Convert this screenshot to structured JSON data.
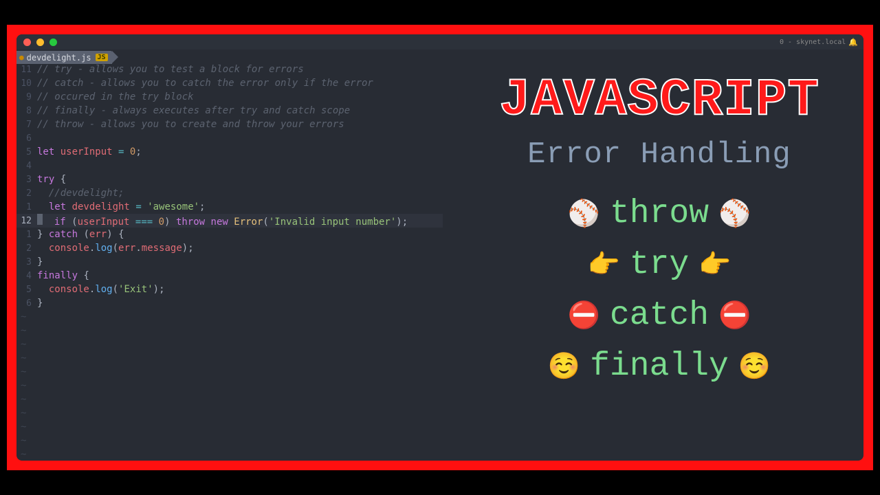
{
  "window": {
    "host_label": "0 - skynet.local"
  },
  "tab": {
    "filename": "devdelight.js",
    "badge": "JS"
  },
  "code": {
    "lines": [
      {
        "n": "11",
        "tokens": [
          [
            "cm",
            "// try - allows you to test a block for errors"
          ]
        ]
      },
      {
        "n": "10",
        "tokens": [
          [
            "cm",
            "// catch - allows you to catch the error only if the error"
          ]
        ]
      },
      {
        "n": "9",
        "tokens": [
          [
            "cm",
            "// occured in the try block"
          ]
        ]
      },
      {
        "n": "8",
        "tokens": [
          [
            "cm",
            "// finally - always executes after try and catch scope"
          ]
        ]
      },
      {
        "n": "7",
        "tokens": [
          [
            "cm",
            "// throw - allows you to create and throw your errors"
          ]
        ]
      },
      {
        "n": "6",
        "tokens": []
      },
      {
        "n": "5",
        "tokens": [
          [
            "kw",
            "let "
          ],
          [
            "vr",
            "userInput"
          ],
          [
            "ct",
            " "
          ],
          [
            "op",
            "="
          ],
          [
            "ct",
            " "
          ],
          [
            "nm",
            "0"
          ],
          [
            "pn",
            ";"
          ]
        ]
      },
      {
        "n": "4",
        "tokens": []
      },
      {
        "n": "3",
        "tokens": [
          [
            "kw",
            "try"
          ],
          [
            "ct",
            " "
          ],
          [
            "pn",
            "{"
          ]
        ]
      },
      {
        "n": "2",
        "tokens": [
          [
            "ct",
            "  "
          ],
          [
            "cm",
            "//devdelight;"
          ]
        ]
      },
      {
        "n": "1",
        "tokens": [
          [
            "ct",
            "  "
          ],
          [
            "kw",
            "let "
          ],
          [
            "vr",
            "devdelight"
          ],
          [
            "ct",
            " "
          ],
          [
            "op",
            "="
          ],
          [
            "ct",
            " "
          ],
          [
            "st",
            "'awesome'"
          ],
          [
            "pn",
            ";"
          ]
        ]
      },
      {
        "n": "12",
        "current": true,
        "tokens": [
          [
            "ct",
            "  "
          ],
          [
            "kw",
            "if"
          ],
          [
            "ct",
            " "
          ],
          [
            "pn",
            "("
          ],
          [
            "vr",
            "userInput"
          ],
          [
            "ct",
            " "
          ],
          [
            "op",
            "==="
          ],
          [
            "ct",
            " "
          ],
          [
            "nm",
            "0"
          ],
          [
            "pn",
            ")"
          ],
          [
            "ct",
            " "
          ],
          [
            "kw",
            "throw"
          ],
          [
            "ct",
            " "
          ],
          [
            "kw",
            "new"
          ],
          [
            "ct",
            " "
          ],
          [
            "cl",
            "Error"
          ],
          [
            "pn",
            "("
          ],
          [
            "st",
            "'Invalid input number'"
          ],
          [
            "pn",
            ")"
          ],
          [
            "pn",
            ";"
          ]
        ]
      },
      {
        "n": "1",
        "tokens": [
          [
            "pn",
            "}"
          ],
          [
            "ct",
            " "
          ],
          [
            "kw",
            "catch"
          ],
          [
            "ct",
            " "
          ],
          [
            "pn",
            "("
          ],
          [
            "vr",
            "err"
          ],
          [
            "pn",
            ")"
          ],
          [
            "ct",
            " "
          ],
          [
            "pn",
            "{"
          ]
        ]
      },
      {
        "n": "2",
        "tokens": [
          [
            "ct",
            "  "
          ],
          [
            "vr",
            "console"
          ],
          [
            "pn",
            "."
          ],
          [
            "fn",
            "log"
          ],
          [
            "pn",
            "("
          ],
          [
            "vr",
            "err"
          ],
          [
            "pn",
            "."
          ],
          [
            "pr",
            "message"
          ],
          [
            "pn",
            ")"
          ],
          [
            "pn",
            ";"
          ]
        ]
      },
      {
        "n": "3",
        "tokens": [
          [
            "pn",
            "}"
          ]
        ]
      },
      {
        "n": "4",
        "tokens": [
          [
            "kw",
            "finally"
          ],
          [
            "ct",
            " "
          ],
          [
            "pn",
            "{"
          ]
        ]
      },
      {
        "n": "5",
        "tokens": [
          [
            "ct",
            "  "
          ],
          [
            "vr",
            "console"
          ],
          [
            "pn",
            "."
          ],
          [
            "fn",
            "log"
          ],
          [
            "pn",
            "("
          ],
          [
            "st",
            "'Exit'"
          ],
          [
            "pn",
            ")"
          ],
          [
            "pn",
            ";"
          ]
        ]
      },
      {
        "n": "6",
        "tokens": [
          [
            "pn",
            "}"
          ]
        ]
      }
    ],
    "tildes": 11
  },
  "overlay": {
    "title": "JAVASCRIPT",
    "subtitle": "Error Handling",
    "rows": [
      {
        "emoji": "⚾",
        "word": "throw"
      },
      {
        "emoji": "👉",
        "word": "try"
      },
      {
        "emoji": "⛔",
        "word": "catch"
      },
      {
        "emoji": "☺️",
        "word": "finally"
      }
    ]
  }
}
